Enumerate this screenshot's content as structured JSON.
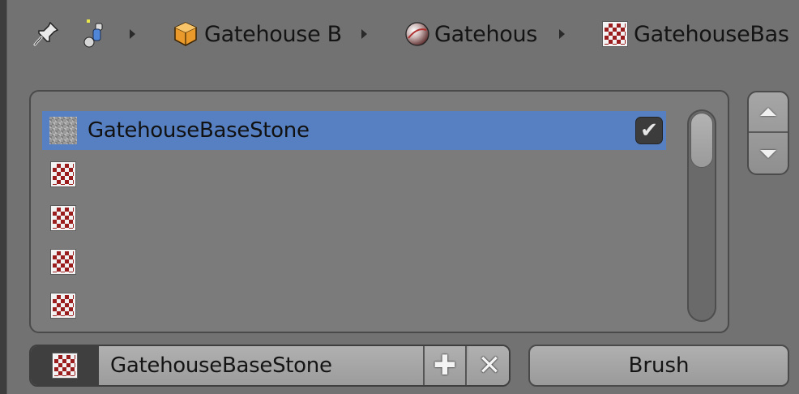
{
  "breadcrumb": {
    "items": [
      {
        "icon": "pin-icon"
      },
      {
        "icon": "scene-data-icon"
      },
      {
        "icon": "object-cube-icon",
        "label": "Gatehouse B"
      },
      {
        "icon": "material-sphere-icon",
        "label": "Gatehous"
      },
      {
        "icon": "texture-checker-icon",
        "label": "GatehouseBas"
      }
    ]
  },
  "texture_slots": {
    "rows": [
      {
        "label": "GatehouseBaseStone",
        "icon": "stone-texture-icon",
        "active": true,
        "enabled": true
      },
      {
        "label": "",
        "icon": "texture-checker-icon",
        "active": false
      },
      {
        "label": "",
        "icon": "texture-checker-icon",
        "active": false
      },
      {
        "label": "",
        "icon": "texture-checker-icon",
        "active": false
      },
      {
        "label": "",
        "icon": "texture-checker-icon",
        "active": false
      }
    ],
    "checkbox_glyph": "✔"
  },
  "move_buttons": {
    "up_icon": "move-up-icon",
    "down_icon": "move-down-icon"
  },
  "texture_selector": {
    "name": "GatehouseBaseStone",
    "add_glyph": "✚",
    "remove_glyph": "✕"
  },
  "brush_button": {
    "label": "Brush"
  },
  "colors": {
    "background": "#727272",
    "selection": "#5680c2",
    "checker_red": "#9b1c1c"
  }
}
